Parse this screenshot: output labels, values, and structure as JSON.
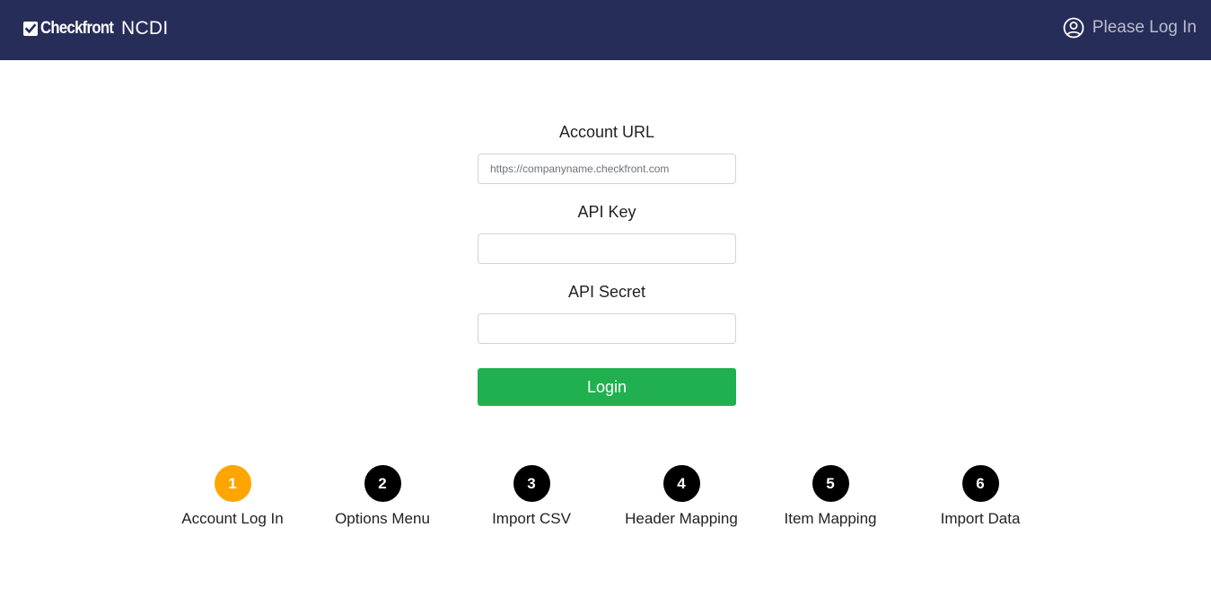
{
  "header": {
    "brand_name": "Checkfront",
    "brand_sub": "NCDI",
    "user_status": "Please Log In",
    "icons": {
      "brand": "checkbox-icon",
      "user": "user-circle-icon"
    }
  },
  "form": {
    "account_url": {
      "label": "Account URL",
      "placeholder": "https://companyname.checkfront.com",
      "value": ""
    },
    "api_key": {
      "label": "API Key",
      "value": ""
    },
    "api_secret": {
      "label": "API Secret",
      "value": ""
    },
    "login_label": "Login"
  },
  "steps": [
    {
      "number": "1",
      "label": "Account Log In",
      "active": true
    },
    {
      "number": "2",
      "label": "Options Menu",
      "active": false
    },
    {
      "number": "3",
      "label": "Import CSV",
      "active": false
    },
    {
      "number": "4",
      "label": "Header Mapping",
      "active": false
    },
    {
      "number": "5",
      "label": "Item Mapping",
      "active": false
    },
    {
      "number": "6",
      "label": "Import Data",
      "active": false
    }
  ],
  "colors": {
    "navbar": "#272d59",
    "login_button": "#21b04f",
    "active_step": "#ffa500",
    "inactive_step": "#000000"
  }
}
